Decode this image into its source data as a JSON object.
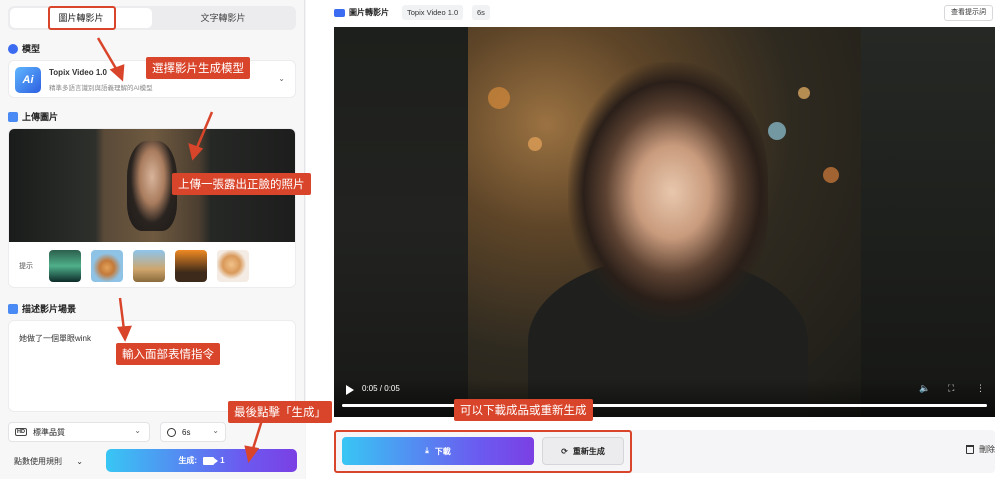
{
  "left": {
    "tabs": [
      "圖片轉影片",
      "文字轉影片"
    ],
    "model_section": "模型",
    "model": {
      "logo": "Ai",
      "name": "Topix Video 1.0",
      "desc": "精準多語言識別與語義理解的AI模型"
    },
    "upload_section": "上傳圖片",
    "hint_label": "提示",
    "desc_section": "描述影片場景",
    "desc_text": "她做了一個單眼wink",
    "quality": {
      "badge": "HD",
      "label": "標準品質"
    },
    "duration": "6s",
    "rule_label": "點數使用規則",
    "generate": {
      "label": "生成:",
      "count": "1"
    }
  },
  "right": {
    "title": "圖片轉影片",
    "model_chip": "Topix Video 1.0",
    "duration_chip": "6s",
    "tips_button": "查看提示詞",
    "video": {
      "time": "0:05 / 0:05",
      "progress": 1.0
    },
    "download_label": "下載",
    "regen_label": "重新生成",
    "delete_label": "刪除"
  },
  "annotations": {
    "model": "選擇影片生成模型",
    "upload": "上傳一張露出正臉的照片",
    "prompt": "輸入面部表情指令",
    "generate": "最後點擊「生成」",
    "download": "可以下載成品或重新生成"
  },
  "colors": {
    "accent": "#d9452b",
    "gradient_start": "#38c6f4",
    "gradient_end": "#7b3fe4"
  }
}
